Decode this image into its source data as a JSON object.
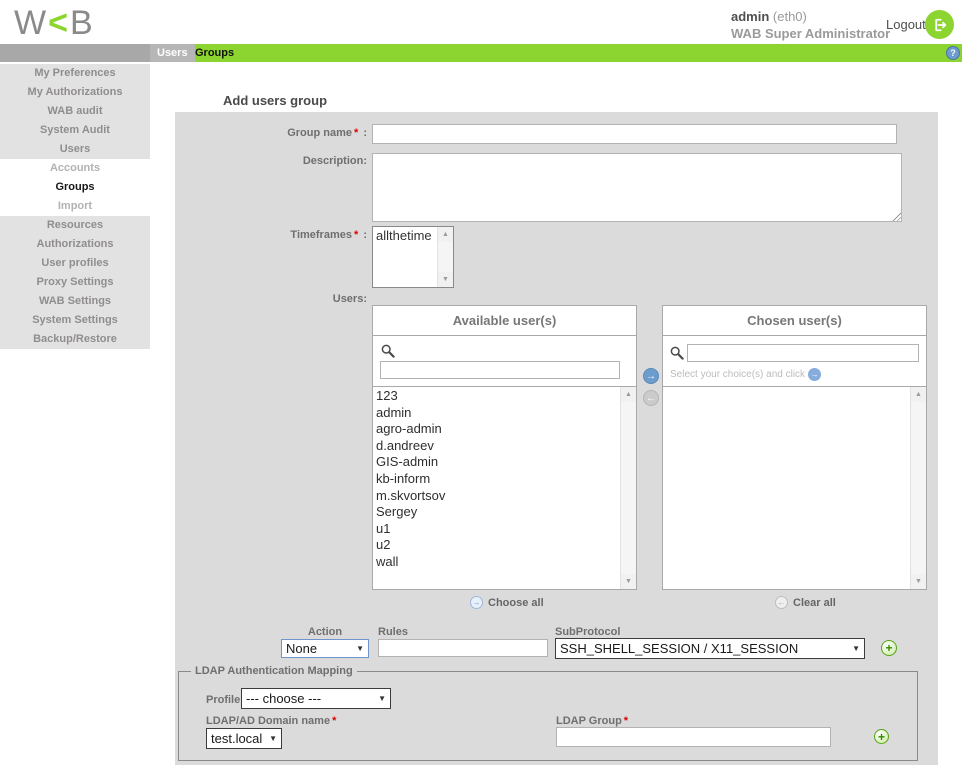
{
  "header": {
    "logo_w": "W",
    "logo_mark": "<",
    "logo_b": "B",
    "username": "admin",
    "interface": " (eth0)",
    "role": "WAB Super Administrator",
    "logout": "Logout"
  },
  "tabbar": {
    "tabs": [
      {
        "label": "Users"
      },
      {
        "label": "Groups"
      }
    ]
  },
  "sidebar": {
    "items": [
      {
        "label": "My Preferences"
      },
      {
        "label": "My Authorizations"
      },
      {
        "label": "WAB audit"
      },
      {
        "label": "System Audit"
      },
      {
        "label": "Users"
      },
      {
        "label": "Accounts"
      },
      {
        "label": "Groups"
      },
      {
        "label": "Import"
      },
      {
        "label": "Resources"
      },
      {
        "label": "Authorizations"
      },
      {
        "label": "User profiles"
      },
      {
        "label": "Proxy Settings"
      },
      {
        "label": "WAB Settings"
      },
      {
        "label": "System Settings"
      },
      {
        "label": "Backup/Restore"
      }
    ]
  },
  "form": {
    "title": "Add users group",
    "group_name": {
      "label": "Group name",
      "value": ""
    },
    "description": {
      "label": "Description:",
      "value": ""
    },
    "timeframes": {
      "label": "Timeframes",
      "options": [
        "allthetime"
      ]
    },
    "users_label": "Users:",
    "available": {
      "title": "Available user(s)",
      "search_value": "",
      "items": [
        "123",
        "admin",
        "agro-admin",
        "d.andreev",
        "GIS-admin",
        "kb-inform",
        "m.skvortsov",
        "Sergey",
        "u1",
        "u2",
        "wall"
      ]
    },
    "chosen": {
      "title": "Chosen user(s)",
      "search_value": "",
      "hint": "Select your choice(s) and click"
    },
    "choose_all": "Choose all",
    "clear_all": "Clear all",
    "action": {
      "label": "Action",
      "value": "None"
    },
    "rules": {
      "label": "Rules",
      "value": ""
    },
    "subprotocol": {
      "label": "SubProtocol",
      "value": "SSH_SHELL_SESSION / X11_SESSION"
    },
    "ldap": {
      "legend": "LDAP Authentication Mapping",
      "profile": {
        "label": "Profile",
        "value": "--- choose ---"
      },
      "domain": {
        "label": "LDAP/AD Domain name",
        "value": "test.local"
      },
      "group": {
        "label": "LDAP Group",
        "value": ""
      }
    }
  },
  "punct": {
    "star": "*",
    "colon": ":"
  },
  "icons": {
    "caret": "▼",
    "up": "▲",
    "down": "▼",
    "arrow_right": "→",
    "arrow_left": "←",
    "plus": "+",
    "question": "?"
  },
  "colors": {
    "accent_green": "#8cd42f",
    "tab_silver": "#b6b6b6",
    "blue": "#6d9cce",
    "panel_gray": "#dbdbdb"
  }
}
